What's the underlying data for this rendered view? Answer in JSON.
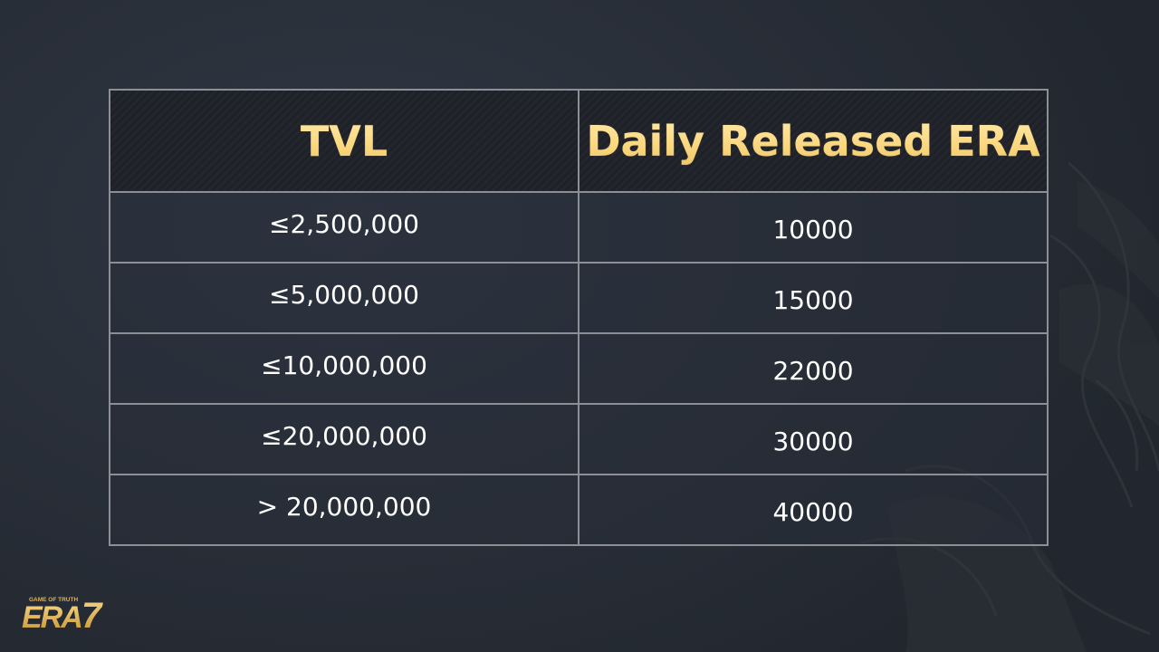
{
  "table": {
    "headers": [
      "TVL",
      "Daily Released ERA"
    ],
    "rows": [
      [
        "≤2,500,000",
        "10000"
      ],
      [
        "≤5,000,000",
        "15000"
      ],
      [
        "≤10,000,000",
        "22000"
      ],
      [
        "≤20,000,000",
        "30000"
      ],
      [
        "> 20,000,000",
        "40000"
      ]
    ]
  },
  "logo": {
    "tagline": "GAME OF TRUTH",
    "wordmark": "ERA",
    "number": "7"
  },
  "colors": {
    "header_text": "#f7d57a",
    "body_text": "#ffffff",
    "border": "#8c8f95",
    "background": "#2a303a",
    "logo_gold": "#e3b24c"
  }
}
